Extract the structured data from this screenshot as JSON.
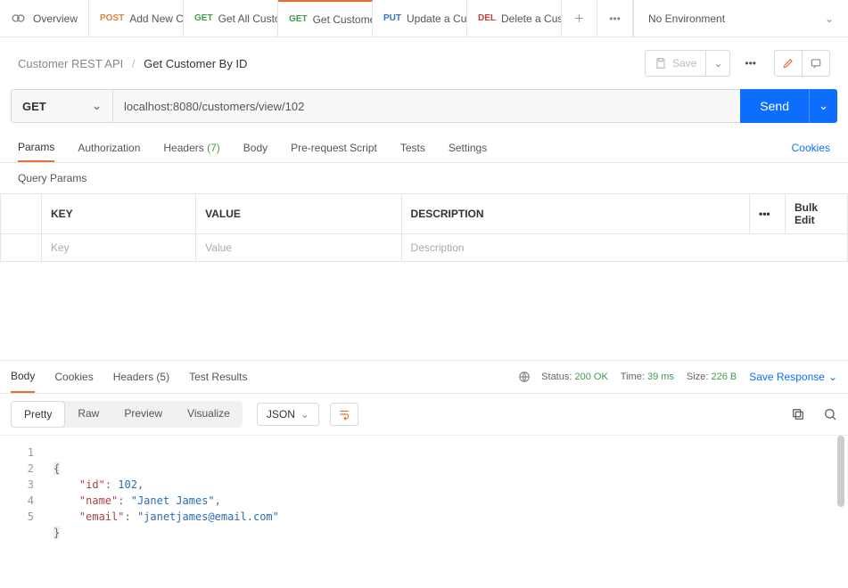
{
  "tabs": {
    "overview": "Overview",
    "items": [
      {
        "method": "POST",
        "label": "Add New C"
      },
      {
        "method": "GET",
        "label": "Get All Custo"
      },
      {
        "method": "GET",
        "label": "Get Custome"
      },
      {
        "method": "PUT",
        "label": "Update a Cu"
      },
      {
        "method": "DEL",
        "label": "Delete a Cus"
      }
    ],
    "active_index": 2
  },
  "environment": {
    "label": "No Environment"
  },
  "breadcrumb": {
    "collection": "Customer REST API",
    "request": "Get Customer By ID"
  },
  "header_actions": {
    "save": "Save"
  },
  "request": {
    "method": "GET",
    "url": "localhost:8080/customers/view/102",
    "send": "Send"
  },
  "req_tabs": {
    "params": "Params",
    "auth": "Authorization",
    "headers_label": "Headers",
    "headers_count": "(7)",
    "body": "Body",
    "prereq": "Pre-request Script",
    "tests": "Tests",
    "settings": "Settings",
    "cookies": "Cookies"
  },
  "query_params": {
    "title": "Query Params",
    "headers": {
      "key": "KEY",
      "value": "VALUE",
      "desc": "DESCRIPTION",
      "bulk": "Bulk Edit"
    },
    "placeholders": {
      "key": "Key",
      "value": "Value",
      "desc": "Description"
    }
  },
  "response": {
    "tabs": {
      "body": "Body",
      "cookies": "Cookies",
      "headers_label": "Headers",
      "headers_count": "(5)",
      "tests": "Test Results"
    },
    "status_label": "Status:",
    "status_value": "200 OK",
    "time_label": "Time:",
    "time_value": "39 ms",
    "size_label": "Size:",
    "size_value": "226 B",
    "save": "Save Response"
  },
  "viewer": {
    "pretty": "Pretty",
    "raw": "Raw",
    "preview": "Preview",
    "visualize": "Visualize",
    "format": "JSON"
  },
  "body_json": {
    "line1": "{",
    "line2_key": "\"id\"",
    "line2_val": "102",
    "line3_key": "\"name\"",
    "line3_val": "\"Janet James\"",
    "line4_key": "\"email\"",
    "line4_val": "\"janetjames@email.com\"",
    "line5": "}",
    "nums": [
      "1",
      "2",
      "3",
      "4",
      "5"
    ]
  }
}
